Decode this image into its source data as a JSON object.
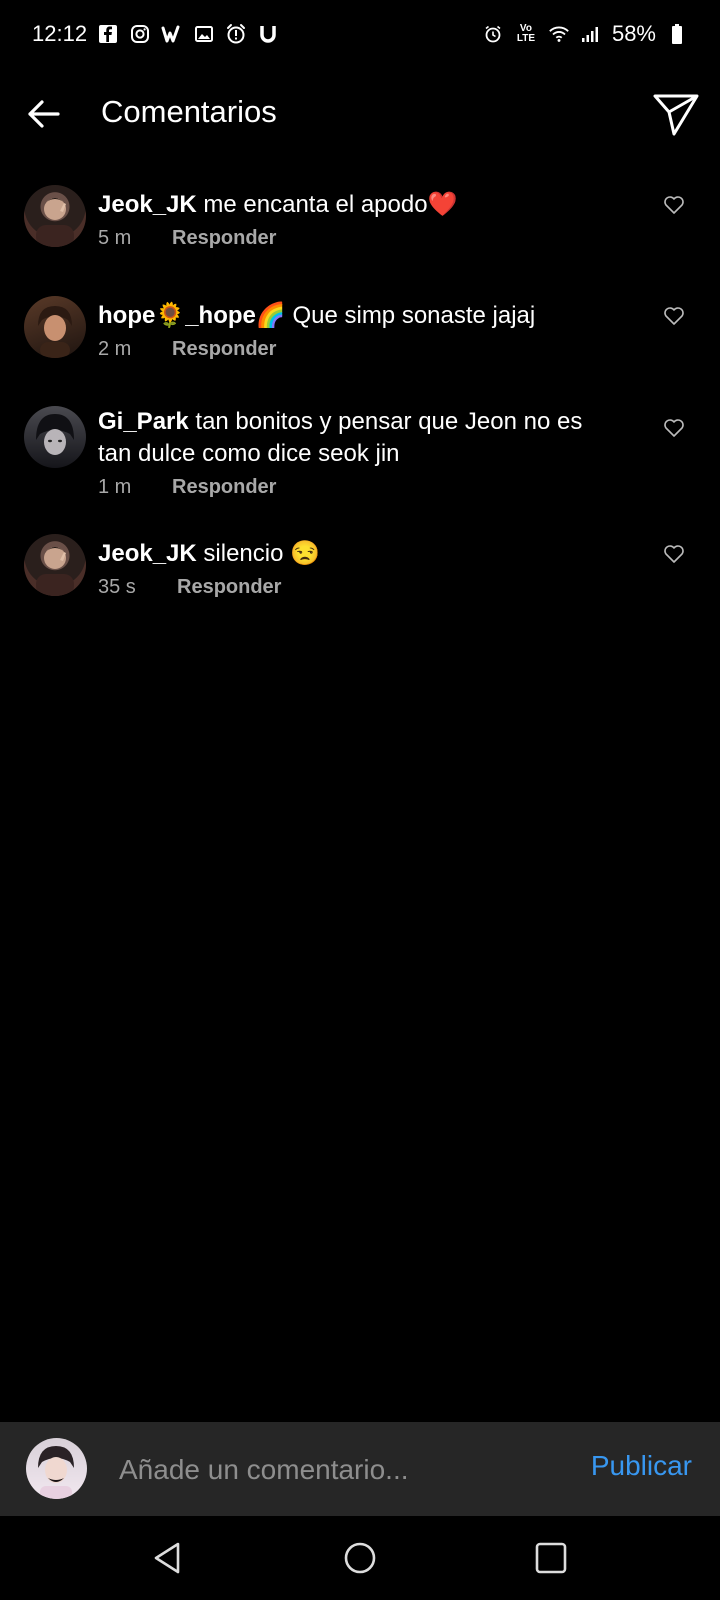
{
  "status_bar": {
    "time": "12:12",
    "left_icons": [
      "facebook-icon",
      "instagram-icon",
      "wattpad-icon",
      "gallery-icon",
      "alarm-notice-icon",
      "u-icon"
    ],
    "right_icons": [
      "alarm-icon",
      "volte-icon",
      "wifi-icon",
      "signal-icon"
    ],
    "volte_label": "Vo LTE",
    "battery": "58%"
  },
  "header": {
    "title": "Comentarios"
  },
  "comments": [
    {
      "username": "Jeok_JK",
      "text": " me encanta el apodo❤️",
      "time": "5 m",
      "reply": "Responder"
    },
    {
      "username": "hope🌻_hope🌈",
      "text": " Que simp sonaste jajaj",
      "time": "2 m",
      "reply": "Responder"
    },
    {
      "username": "Gi_Park",
      "text": " tan bonitos y pensar que Jeon no es tan dulce como dice seok jin",
      "time": "1 m",
      "reply": "Responder"
    },
    {
      "username": "Jeok_JK",
      "text": " silencio 😒",
      "time": "35 s",
      "reply": "Responder"
    }
  ],
  "composer": {
    "placeholder": "Añade un comentario...",
    "publish_label": "Publicar"
  },
  "colors": {
    "background": "#000000",
    "composer_bg": "#262626",
    "accent": "#3897f0",
    "meta": "#a8a8a8"
  }
}
